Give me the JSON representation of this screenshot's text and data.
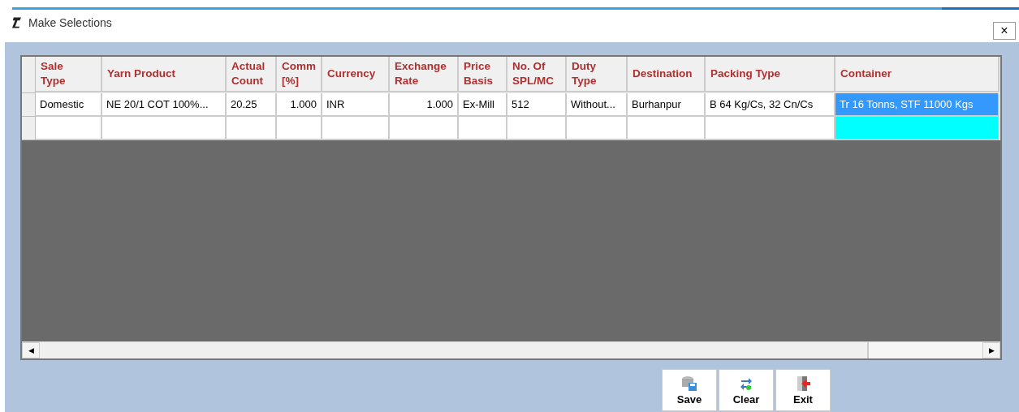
{
  "window": {
    "title": "Make Selections",
    "close": "×"
  },
  "grid": {
    "columns": [
      {
        "label": "Sale Type",
        "kind": "text"
      },
      {
        "label": "Yarn Product",
        "kind": "text"
      },
      {
        "label": "Actual Count",
        "kind": "text"
      },
      {
        "label": "Comm [%]",
        "kind": "number"
      },
      {
        "label": "Currency",
        "kind": "text"
      },
      {
        "label": "Exchange Rate",
        "kind": "number"
      },
      {
        "label": "Price Basis",
        "kind": "text"
      },
      {
        "label": "No. Of SPL/MC",
        "kind": "text"
      },
      {
        "label": "Duty Type",
        "kind": "text"
      },
      {
        "label": "Destination",
        "kind": "text"
      },
      {
        "label": "Packing Type",
        "kind": "text"
      },
      {
        "label": "Container",
        "kind": "text"
      }
    ],
    "rows": [
      {
        "cells": [
          {
            "text": "Domestic",
            "selected": false
          },
          {
            "text": "NE 20/1 COT 100%...",
            "selected": false
          },
          {
            "text": "20.25",
            "selected": false
          },
          {
            "text": "1.000",
            "selected": false
          },
          {
            "text": "INR",
            "selected": false
          },
          {
            "text": "1.000",
            "selected": false
          },
          {
            "text": "Ex-Mill",
            "selected": false
          },
          {
            "text": "512",
            "selected": false
          },
          {
            "text": "Without...",
            "selected": false
          },
          {
            "text": "Burhanpur",
            "selected": false
          },
          {
            "text": "B 64 Kg/Cs, 32 Cn/Cs",
            "selected": false
          },
          {
            "text": "Tr 16 Tonns, STF 11000 Kgs",
            "selected": true
          }
        ]
      },
      {
        "cells": [
          {
            "selected": false
          },
          {
            "selected": false
          },
          {
            "selected": false
          },
          {
            "selected": false
          },
          {
            "selected": false
          },
          {
            "selected": false
          },
          {
            "selected": false
          },
          {
            "selected": false
          },
          {
            "selected": false
          },
          {
            "selected": false
          },
          {
            "selected": false
          },
          {
            "selected": true
          }
        ]
      }
    ],
    "scroll_left": "◀",
    "scroll_right": "▶"
  },
  "buttons": [
    {
      "label": "Save",
      "kind": "save"
    },
    {
      "label": "Clear",
      "kind": "clear"
    },
    {
      "label": "Exit",
      "kind": "exit"
    }
  ]
}
